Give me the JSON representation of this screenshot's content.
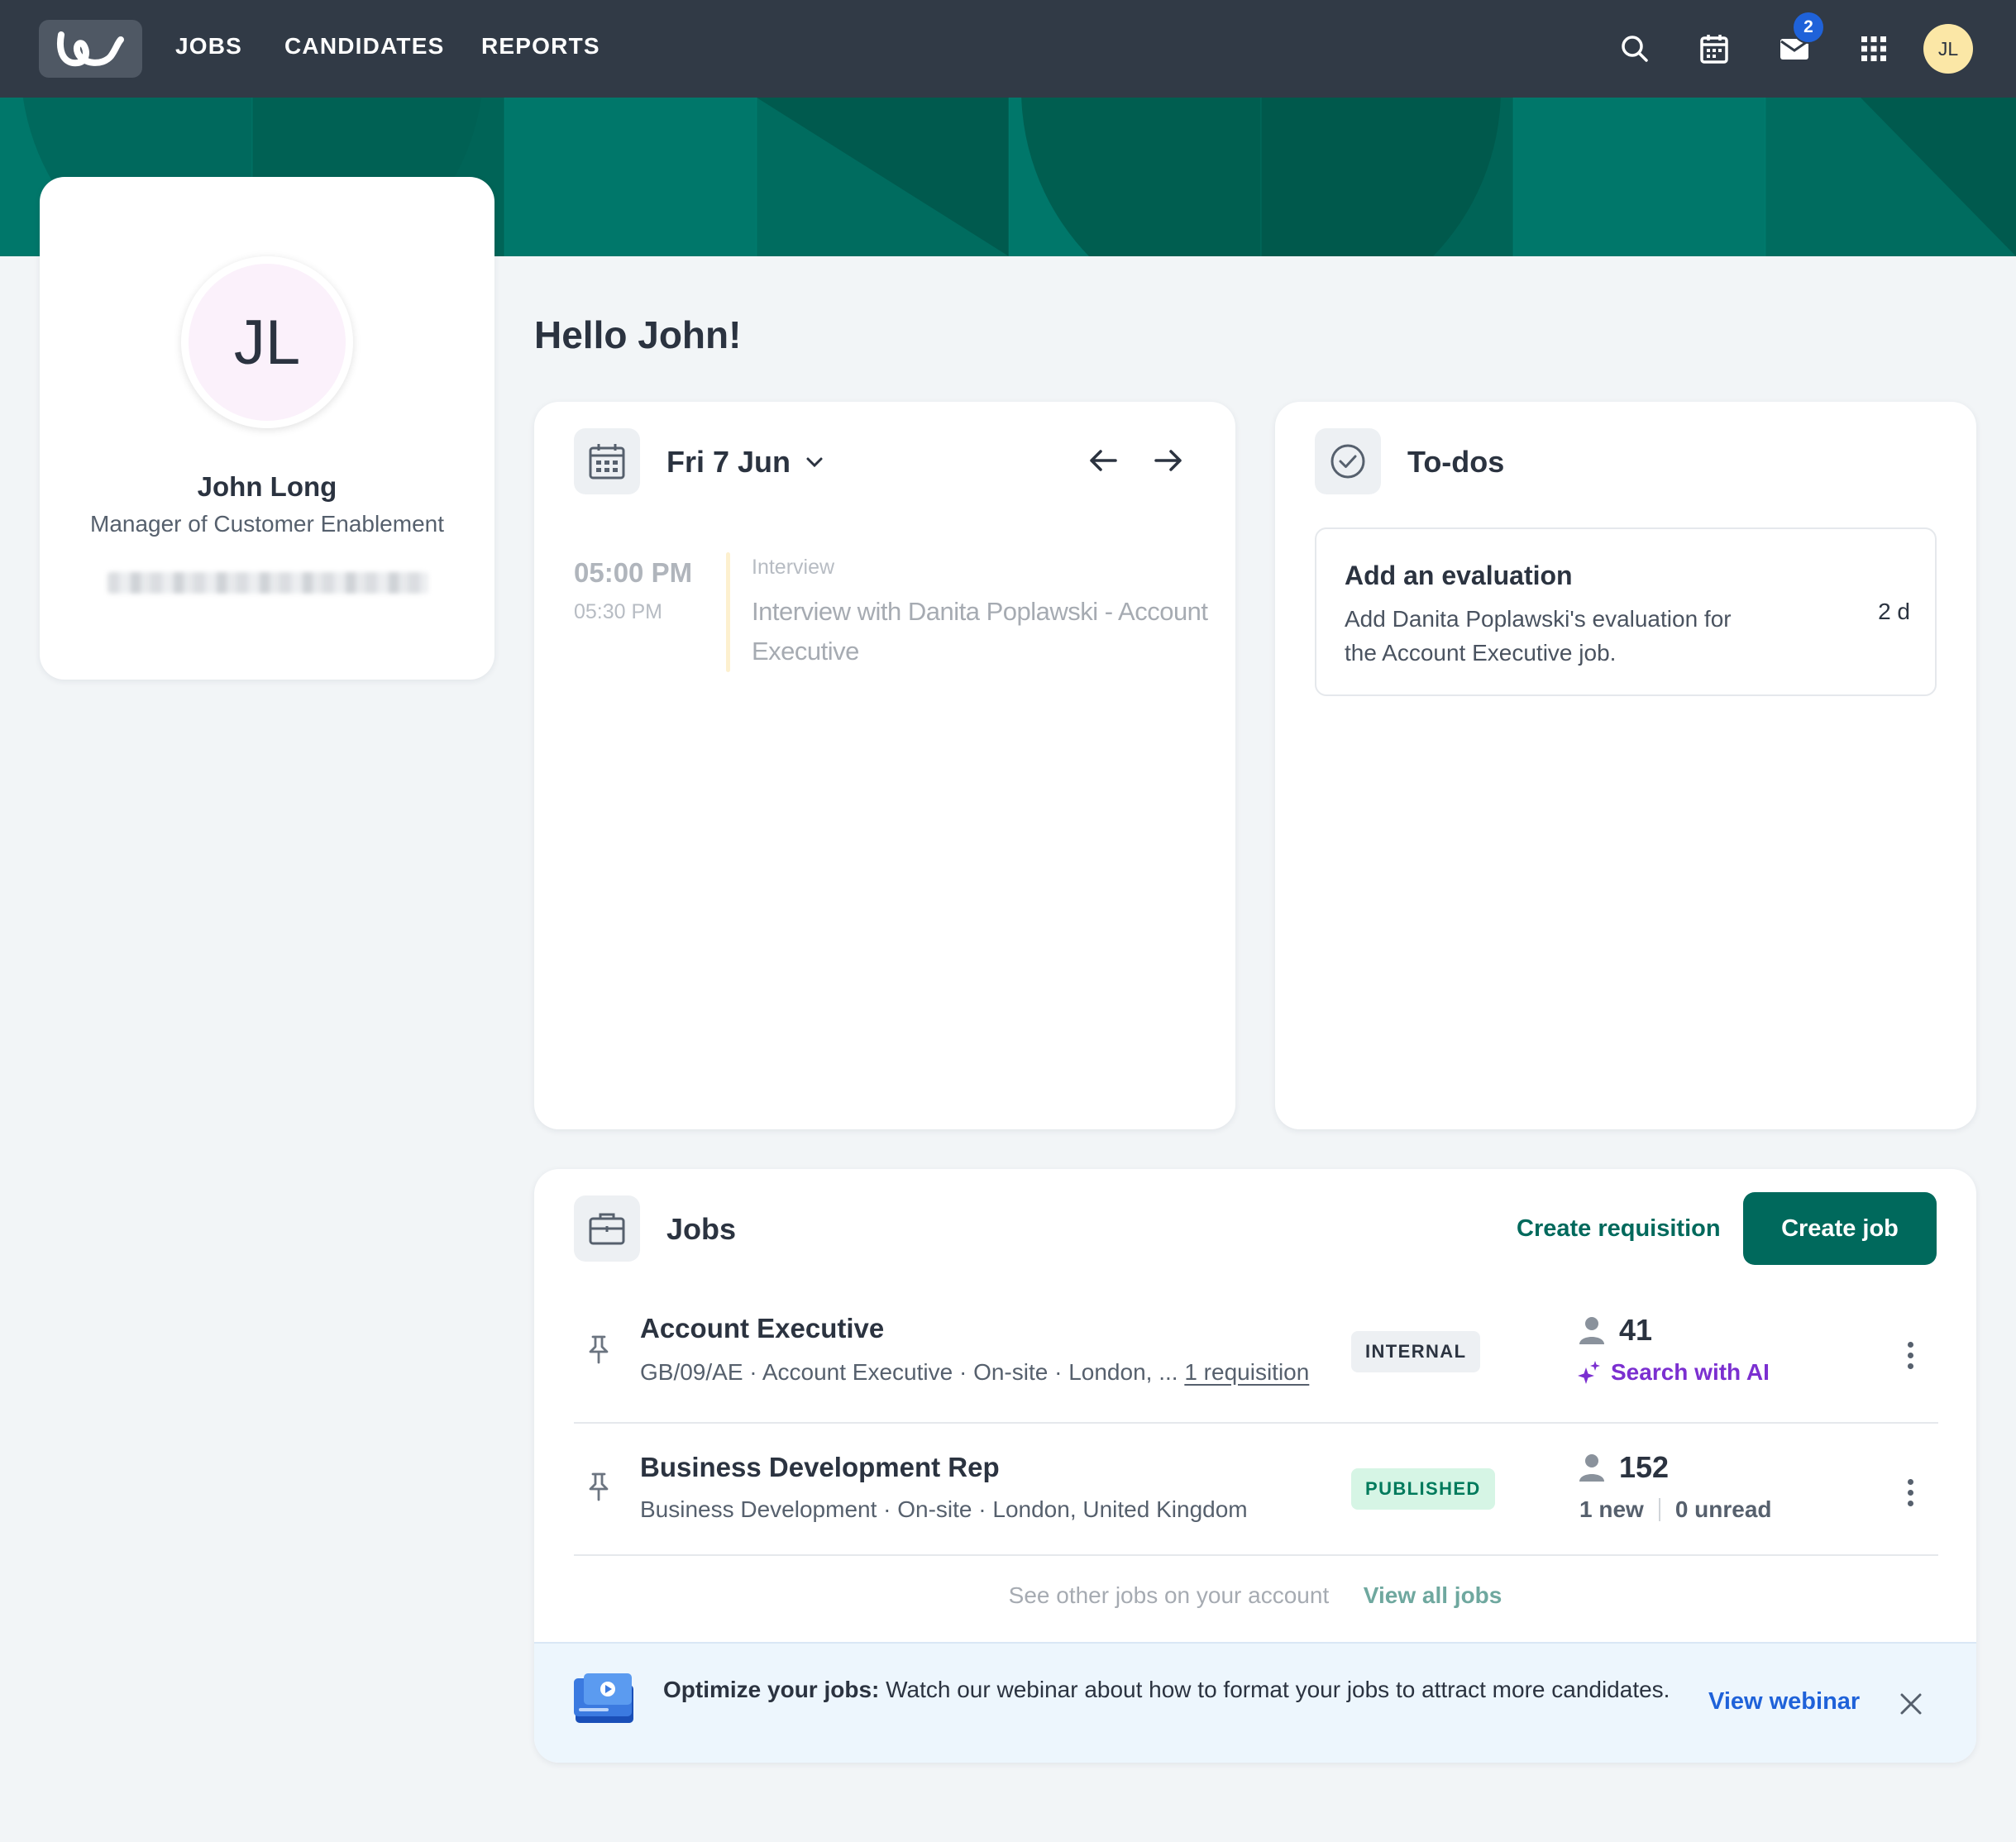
{
  "nav": {
    "links": [
      "JOBS",
      "CANDIDATES",
      "REPORTS"
    ],
    "inbox_badge": "2",
    "avatar_initials": "JL",
    "icons": [
      "search-icon",
      "calendar-icon",
      "mail-icon",
      "apps-grid-icon"
    ]
  },
  "profile": {
    "initials": "JL",
    "name": "John Long",
    "title": "Manager of Customer Enablement"
  },
  "greeting": "Hello John!",
  "calendar": {
    "date": "Fri 7 Jun",
    "event": {
      "start": "05:00 PM",
      "end": "05:30 PM",
      "type": "Interview",
      "title": "Interview with Danita Poplawski - Account Executive"
    }
  },
  "todos": {
    "title": "To-dos",
    "items": [
      {
        "title": "Add an evaluation",
        "description": "Add Danita Poplawski's evaluation for the Account Executive job.",
        "age": "2 d"
      }
    ]
  },
  "jobs": {
    "title": "Jobs",
    "create_requisition": "Create requisition",
    "create_job": "Create job",
    "rows": [
      {
        "title": "Account Executive",
        "meta": "GB/09/AE · Account Executive · On-site · London, ...",
        "requisition_link": "1 requisition",
        "tag": "INTERNAL",
        "count": "41",
        "ai_link": "Search with AI"
      },
      {
        "title": "Business Development Rep",
        "meta": "Business Development · On-site · London, United Kingdom",
        "tag": "PUBLISHED",
        "count": "152",
        "new": "1 new",
        "unread": "0 unread"
      }
    ],
    "footer_text": "See other jobs on your account",
    "footer_link": "View all jobs"
  },
  "promo": {
    "bold": "Optimize your jobs:",
    "text": " Watch our webinar about how to format your jobs to attract more candidates.",
    "link": "View webinar"
  },
  "colors": {
    "nav_bg": "#313a46",
    "brand_green": "#00695c",
    "hero_green": "#00776a",
    "link_blue": "#1f62d9",
    "ai_purple": "#7b2fd0"
  }
}
